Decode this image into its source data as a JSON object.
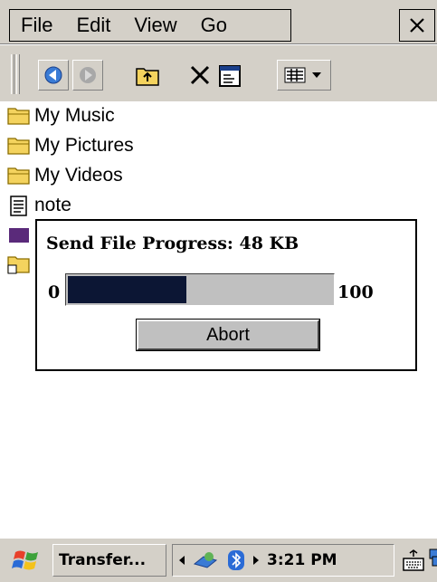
{
  "menubar": {
    "items": [
      {
        "label": "File"
      },
      {
        "label": "Edit"
      },
      {
        "label": "View"
      },
      {
        "label": "Go"
      }
    ],
    "close_icon": "close-icon"
  },
  "toolbar": {
    "buttons": [
      "back-icon",
      "forward-icon",
      "up-folder-icon",
      "delete-icon",
      "properties-icon",
      "view-menu-icon"
    ]
  },
  "file_list": {
    "items": [
      {
        "label": "My Music",
        "icon": "folder-icon"
      },
      {
        "label": "My Pictures",
        "icon": "folder-icon"
      },
      {
        "label": "My Videos",
        "icon": "folder-icon"
      },
      {
        "label": "note",
        "icon": "text-file-icon"
      }
    ]
  },
  "dialog": {
    "title": "Send File Progress: 48 KB",
    "range_min": "0",
    "range_max": "100",
    "progress": 0.45,
    "abort_label": "Abort",
    "fill_color": "#0c1634"
  },
  "taskbar": {
    "start_icon": "start-flag-icon",
    "task_label": "Transfer...",
    "clock": "3:21 PM",
    "tray_icons": [
      "tray-left-arrow-icon",
      "network-icon",
      "bluetooth-icon",
      "tray-right-arrow-icon"
    ],
    "keyboard_icon": "keyboard-icon"
  }
}
